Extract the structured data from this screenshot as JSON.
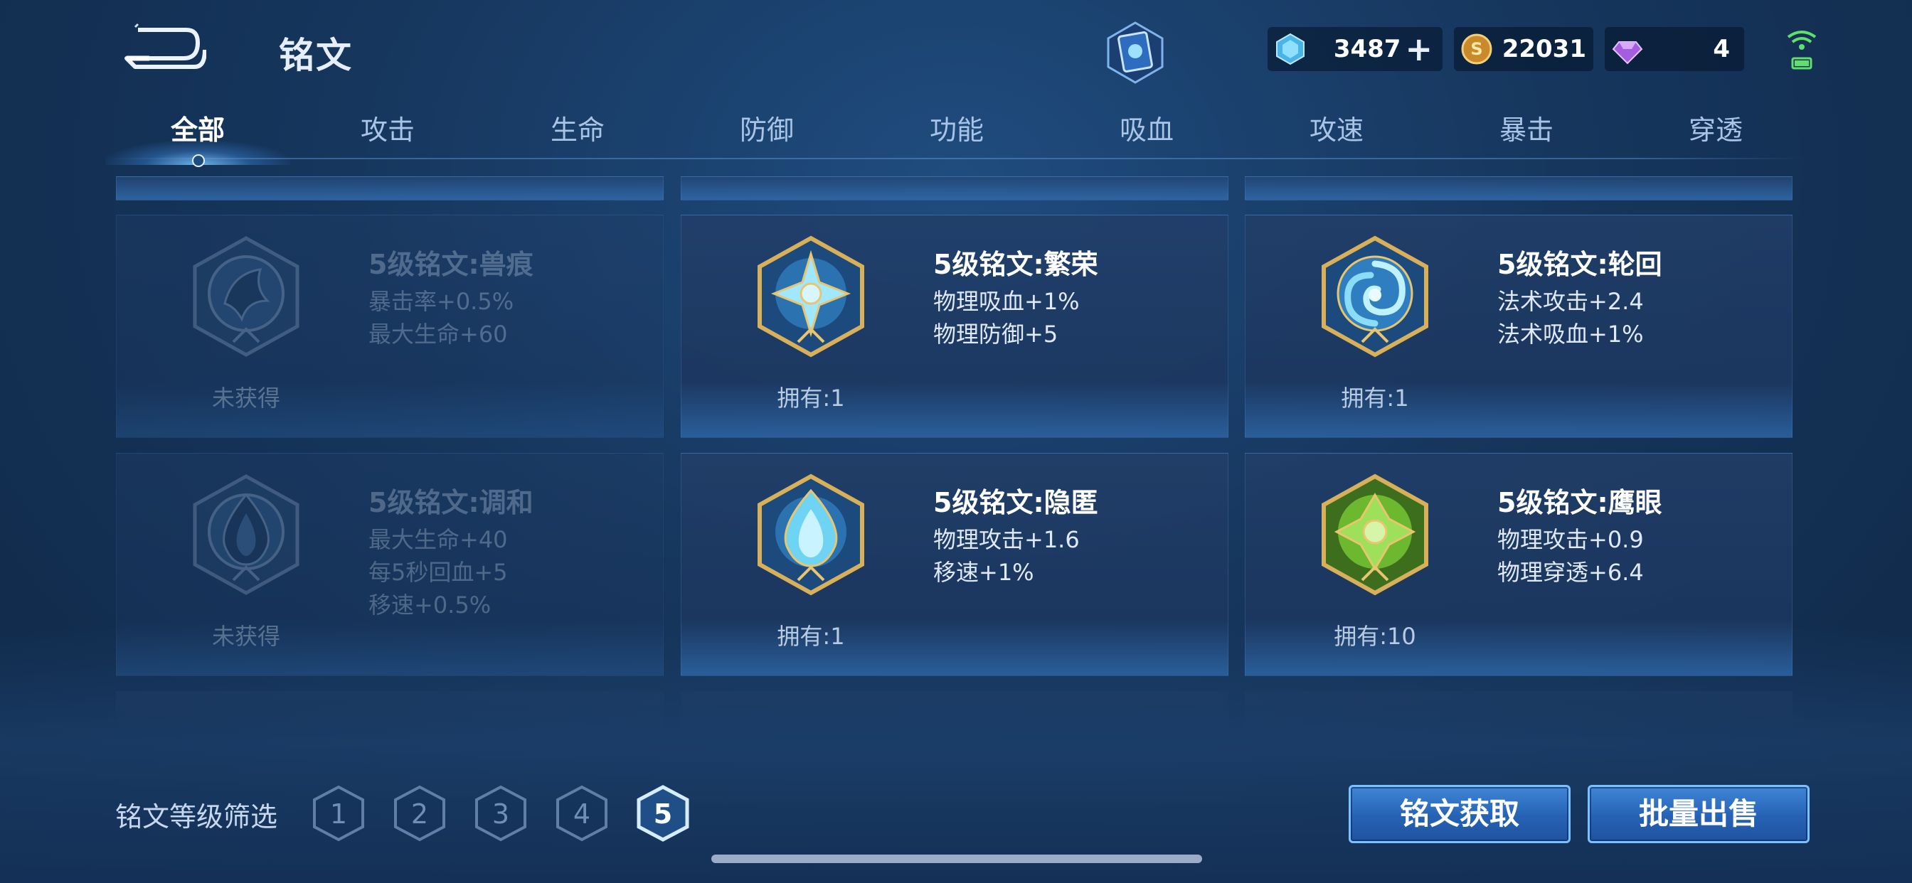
{
  "header": {
    "title": "铭文",
    "currencies": [
      {
        "name": "diamond",
        "value": "3487",
        "has_add": true
      },
      {
        "name": "gold-coin",
        "value": "22031",
        "has_add": false
      },
      {
        "name": "crystal",
        "value": "4",
        "has_add": false
      }
    ]
  },
  "tabs": [
    {
      "label": "全部",
      "active": true
    },
    {
      "label": "攻击",
      "active": false
    },
    {
      "label": "生命",
      "active": false
    },
    {
      "label": "防御",
      "active": false
    },
    {
      "label": "功能",
      "active": false
    },
    {
      "label": "吸血",
      "active": false
    },
    {
      "label": "攻速",
      "active": false
    },
    {
      "label": "暴击",
      "active": false
    },
    {
      "label": "穿透",
      "active": false
    }
  ],
  "cards": [
    {
      "name": "5级铭文:兽痕",
      "stats": [
        "暴击率+0.5%",
        "最大生命+60"
      ],
      "owned": "未获得",
      "obtained": false,
      "icon": "leaf-emblem-icon",
      "color": "#5f8ab8"
    },
    {
      "name": "5级铭文:繁荣",
      "stats": [
        "物理吸血+1%",
        "物理防御+5"
      ],
      "owned": "拥有:1",
      "obtained": true,
      "icon": "star-emblem-icon",
      "color": "#4fc8e8"
    },
    {
      "name": "5级铭文:轮回",
      "stats": [
        "法术攻击+2.4",
        "法术吸血+1%"
      ],
      "owned": "拥有:1",
      "obtained": true,
      "icon": "swirl-emblem-icon",
      "color": "#4fc8e8"
    },
    {
      "name": "5级铭文:调和",
      "stats": [
        "最大生命+40",
        "每5秒回血+5",
        "移速+0.5%"
      ],
      "owned": "未获得",
      "obtained": false,
      "icon": "drop-emblem-icon",
      "color": "#5f8ab8"
    },
    {
      "name": "5级铭文:隐匿",
      "stats": [
        "物理攻击+1.6",
        "移速+1%"
      ],
      "owned": "拥有:1",
      "obtained": true,
      "icon": "flame-emblem-icon",
      "color": "#4fc8e8"
    },
    {
      "name": "5级铭文:鹰眼",
      "stats": [
        "物理攻击+0.9",
        "物理穿透+6.4"
      ],
      "owned": "拥有:10",
      "obtained": true,
      "icon": "eagle-emblem-icon",
      "color": "#7cc23a"
    }
  ],
  "filter": {
    "label": "铭文等级筛选",
    "levels": [
      "1",
      "2",
      "3",
      "4",
      "5"
    ],
    "selected": "5"
  },
  "actions": {
    "obtain_label": "铭文获取",
    "sell_label": "批量出售"
  }
}
